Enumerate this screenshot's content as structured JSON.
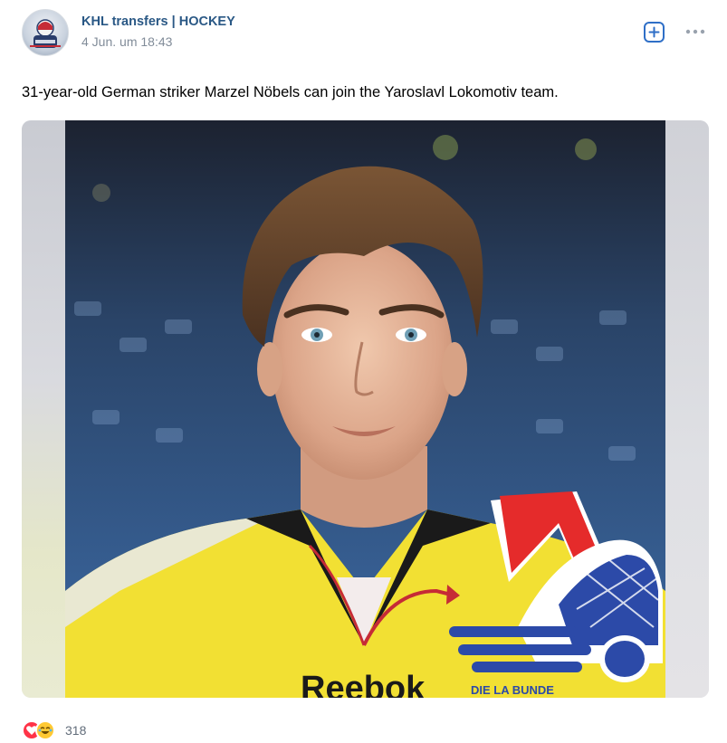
{
  "post": {
    "author": "KHL transfers | HOCKEY",
    "date": "4 Jun. um 18:43",
    "text": "31-year-old German striker Marzel Nöbels can join the Yaroslavl Lokomotiv team.",
    "reaction_count": "318"
  },
  "photo": {
    "jersey_text": "Reebok",
    "badge_text": "DIE LA BUNDE"
  },
  "icons": {
    "add": "add-to-bookmarks-icon",
    "more": "more-dots-icon",
    "reaction_1": "heart-icon",
    "reaction_2": "laughing-face-icon"
  },
  "colors": {
    "author_link": "#2a5885",
    "date": "#818c99",
    "accent": "#2f6fc7",
    "heart": "#ff3347",
    "jersey": "#f2e033",
    "logo_red": "#e52b2b",
    "logo_blue": "#2c4aa8"
  }
}
